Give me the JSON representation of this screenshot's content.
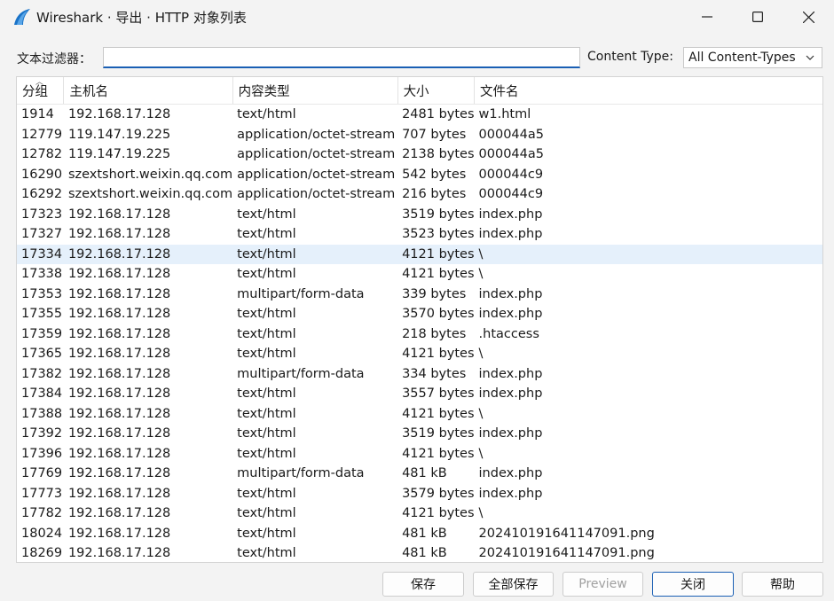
{
  "window": {
    "title": "Wireshark · 导出 · HTTP 对象列表"
  },
  "filter": {
    "label": "文本过滤器：",
    "value": ""
  },
  "content_type": {
    "label": "Content Type:",
    "selected": "All Content-Types"
  },
  "table": {
    "headers": [
      "分组",
      "主机名",
      "内容类型",
      "大小",
      "文件名"
    ],
    "rows": [
      [
        "1914",
        "192.168.17.128",
        "text/html",
        "2481 bytes",
        "w1.html"
      ],
      [
        "12779",
        "119.147.19.225",
        "application/octet-stream",
        "707 bytes",
        "000044a5"
      ],
      [
        "12782",
        "119.147.19.225",
        "application/octet-stream",
        "2138 bytes",
        "000044a5"
      ],
      [
        "16290",
        "szextshort.weixin.qq.com",
        "application/octet-stream",
        "542 bytes",
        "000044c9"
      ],
      [
        "16292",
        "szextshort.weixin.qq.com",
        "application/octet-stream",
        "216 bytes",
        "000044c9"
      ],
      [
        "17323",
        "192.168.17.128",
        "text/html",
        "3519 bytes",
        "index.php"
      ],
      [
        "17327",
        "192.168.17.128",
        "text/html",
        "3523 bytes",
        "index.php"
      ],
      [
        "17334",
        "192.168.17.128",
        "text/html",
        "4121 bytes",
        "\\"
      ],
      [
        "17338",
        "192.168.17.128",
        "text/html",
        "4121 bytes",
        "\\"
      ],
      [
        "17353",
        "192.168.17.128",
        "multipart/form-data",
        "339 bytes",
        "index.php"
      ],
      [
        "17355",
        "192.168.17.128",
        "text/html",
        "3570 bytes",
        "index.php"
      ],
      [
        "17359",
        "192.168.17.128",
        "text/html",
        "218 bytes",
        ".htaccess"
      ],
      [
        "17365",
        "192.168.17.128",
        "text/html",
        "4121 bytes",
        "\\"
      ],
      [
        "17382",
        "192.168.17.128",
        "multipart/form-data",
        "334 bytes",
        "index.php"
      ],
      [
        "17384",
        "192.168.17.128",
        "text/html",
        "3557 bytes",
        "index.php"
      ],
      [
        "17388",
        "192.168.17.128",
        "text/html",
        "4121 bytes",
        "\\"
      ],
      [
        "17392",
        "192.168.17.128",
        "text/html",
        "3519 bytes",
        "index.php"
      ],
      [
        "17396",
        "192.168.17.128",
        "text/html",
        "4121 bytes",
        "\\"
      ],
      [
        "17769",
        "192.168.17.128",
        "multipart/form-data",
        "481 kB",
        "index.php"
      ],
      [
        "17773",
        "192.168.17.128",
        "text/html",
        "3579 bytes",
        "index.php"
      ],
      [
        "17782",
        "192.168.17.128",
        "text/html",
        "4121 bytes",
        "\\"
      ],
      [
        "18024",
        "192.168.17.128",
        "text/html",
        "481 kB",
        "202410191641147091.png"
      ],
      [
        "18269",
        "192.168.17.128",
        "text/html",
        "481 kB",
        "202410191641147091.png"
      ]
    ],
    "selected_row": 7
  },
  "buttons": {
    "save": "保存",
    "save_all": "全部保存",
    "preview": "Preview",
    "close": "关闭",
    "help": "帮助"
  },
  "colors": {
    "accent": "#1a5fb4",
    "selected_row": "#e5f0fb"
  }
}
